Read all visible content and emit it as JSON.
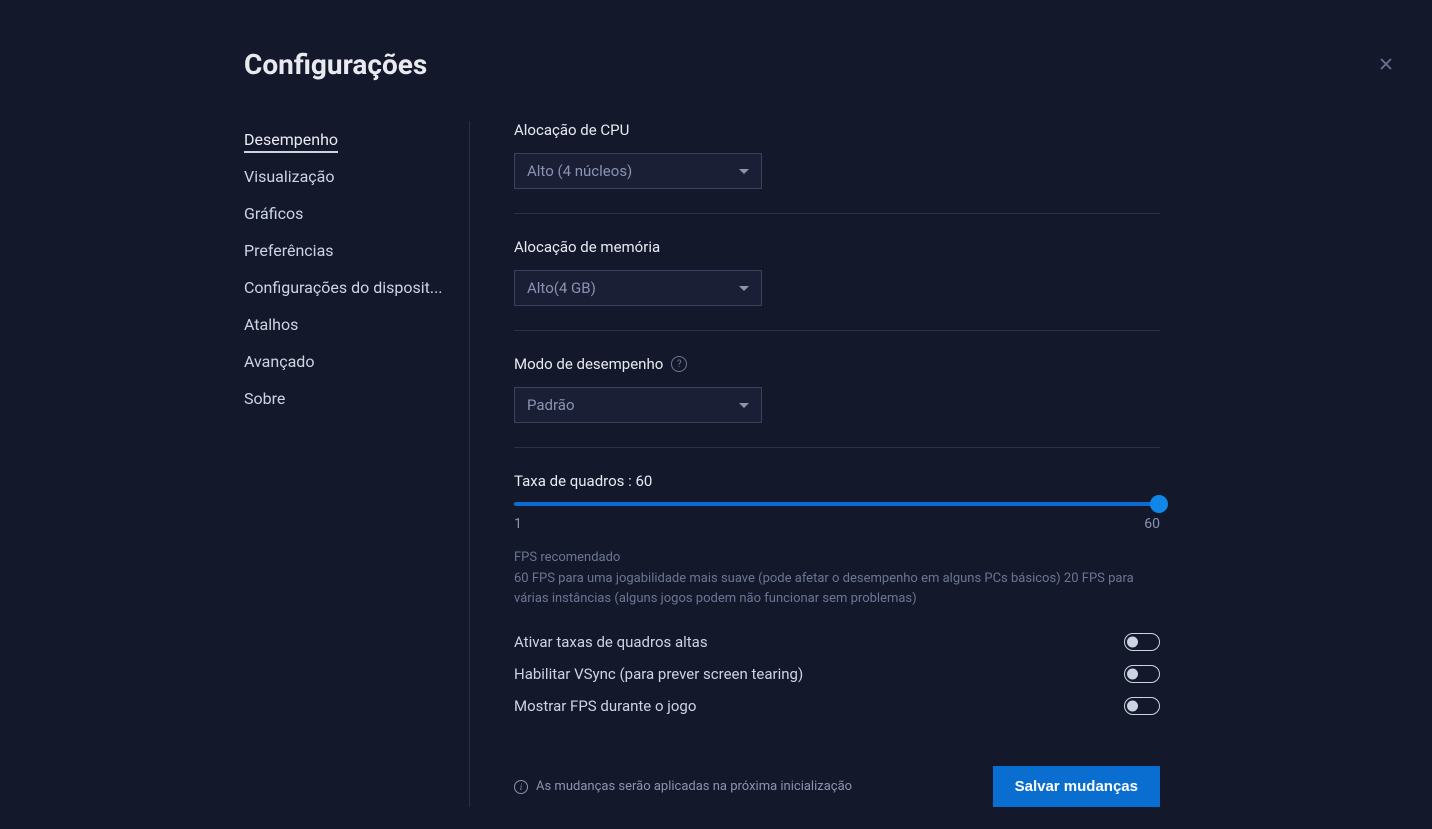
{
  "header": {
    "title": "Configurações"
  },
  "sidebar": {
    "items": [
      {
        "label": "Desempenho",
        "active": true
      },
      {
        "label": "Visualização",
        "active": false
      },
      {
        "label": "Gráficos",
        "active": false
      },
      {
        "label": "Preferências",
        "active": false
      },
      {
        "label": "Configurações do disposit...",
        "active": false
      },
      {
        "label": "Atalhos",
        "active": false
      },
      {
        "label": "Avançado",
        "active": false
      },
      {
        "label": "Sobre",
        "active": false
      }
    ]
  },
  "cpu": {
    "label": "Alocação de CPU",
    "value": "Alto (4 núcleos)"
  },
  "memory": {
    "label": "Alocação de memória",
    "value": "Alto(4 GB)"
  },
  "performance_mode": {
    "label": "Modo de desempenho",
    "value": "Padrão"
  },
  "frame_rate": {
    "label_prefix": "Taxa de quadros : ",
    "value": "60",
    "min": "1",
    "max": "60",
    "hint_title": "FPS recomendado",
    "hint_body": "60 FPS para uma jogabilidade mais suave (pode afetar o desempenho em alguns PCs básicos) 20 FPS para várias instâncias (alguns jogos podem não funcionar sem problemas)"
  },
  "toggles": {
    "high_fps": {
      "label": "Ativar taxas de quadros altas",
      "on": false
    },
    "vsync": {
      "label": "Habilitar VSync (para prever screen tearing)",
      "on": false
    },
    "show_fps": {
      "label": "Mostrar FPS durante o jogo",
      "on": false
    }
  },
  "footer": {
    "info": "As mudanças serão aplicadas na próxima inicialização",
    "save_label": "Salvar mudanças"
  }
}
